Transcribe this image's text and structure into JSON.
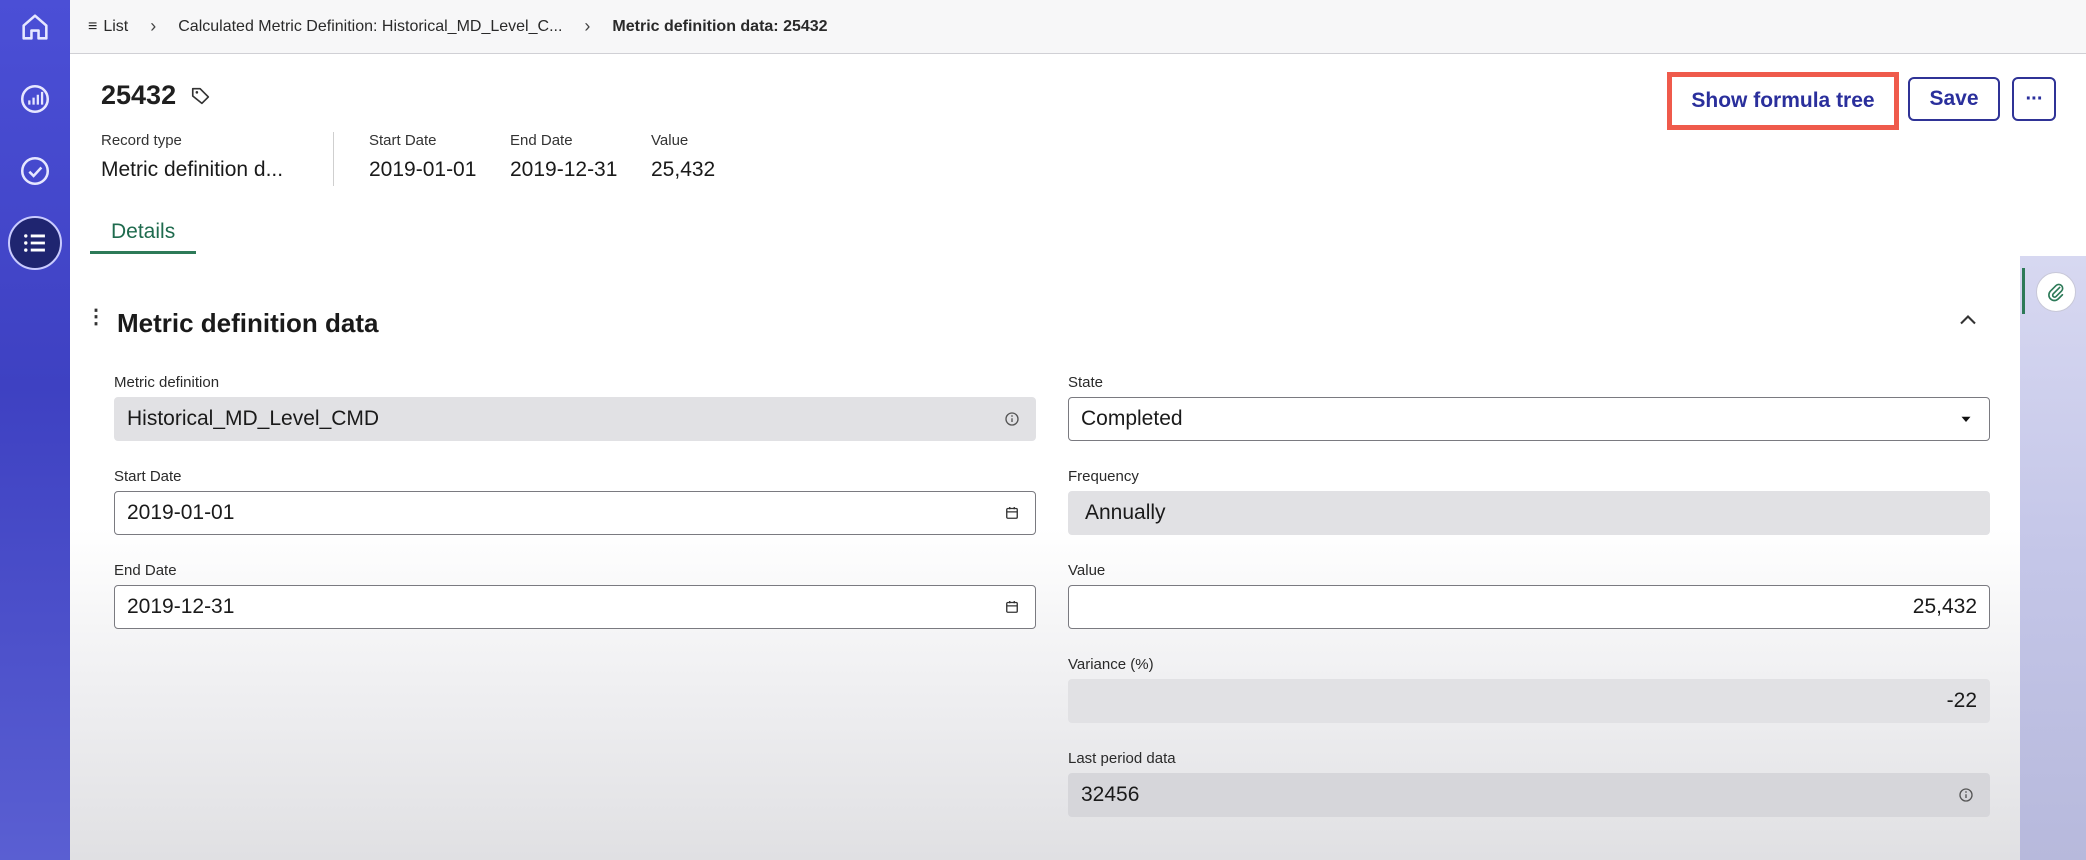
{
  "breadcrumb": {
    "list_label": "List",
    "parent_label": "Calculated Metric Definition: Historical_MD_Level_C...",
    "current_label": "Metric definition data: 25432"
  },
  "header": {
    "record_id": "25432",
    "highlights": [
      {
        "label": "Record type",
        "value": "Metric definition d..."
      },
      {
        "label": "Start Date",
        "value": "2019-01-01"
      },
      {
        "label": "End Date",
        "value": "2019-12-31"
      },
      {
        "label": "Value",
        "value": "25,432"
      }
    ],
    "buttons": {
      "formula_tree": "Show formula tree",
      "save": "Save",
      "more": "···"
    }
  },
  "tabs": [
    {
      "label": "Details",
      "active": true
    }
  ],
  "section": {
    "title": "Metric definition data",
    "fields": {
      "metric_definition": {
        "label": "Metric definition",
        "value": "Historical_MD_Level_CMD"
      },
      "start_date": {
        "label": "Start Date",
        "value": "2019-01-01"
      },
      "end_date": {
        "label": "End Date",
        "value": "2019-12-31"
      },
      "state": {
        "label": "State",
        "value": "Completed"
      },
      "frequency": {
        "label": "Frequency",
        "value": "Annually"
      },
      "value": {
        "label": "Value",
        "value": "25,432"
      },
      "variance": {
        "label": "Variance (%)",
        "value": "-22"
      },
      "last_period": {
        "label": "Last period data",
        "value": "32456"
      }
    }
  },
  "icons": {
    "sidebar": [
      "home-icon",
      "analytics-icon",
      "check-circle-icon",
      "list-icon"
    ],
    "attachment": "paperclip-icon"
  },
  "colors": {
    "sidebar": "#4b4fd6",
    "primary_text": "#2a2f9c",
    "highlight_border": "#ef5a4b",
    "tab_accent": "#2d7a58"
  }
}
